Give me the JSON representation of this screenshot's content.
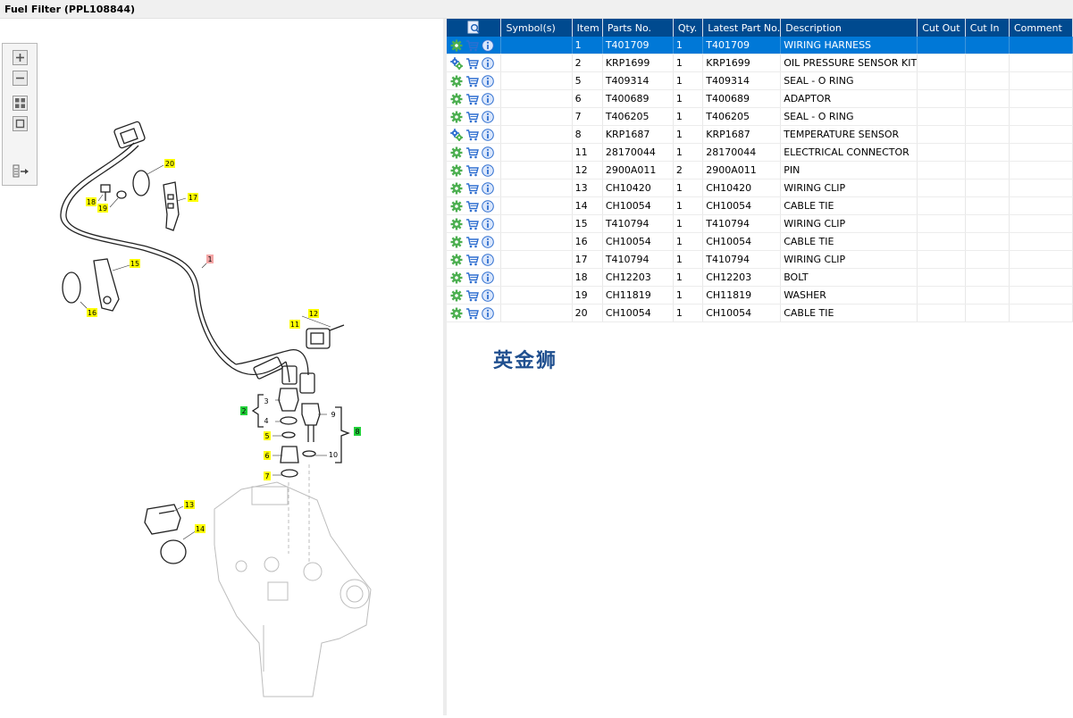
{
  "window": {
    "title": "Fuel Filter (PPL108844)"
  },
  "toolbar": {
    "zoom_in_icon": "plus-icon",
    "zoom_out_icon": "minus-icon",
    "fit_icon": "fit-grid-icon",
    "actual_size_icon": "square-icon",
    "list_icon": "list-arrow-icon"
  },
  "diagram": {
    "callouts": [
      {
        "label": "1",
        "color": "#f4a6a6"
      },
      {
        "label": "2",
        "color": "#22d13a"
      },
      {
        "label": "3",
        "color": "none"
      },
      {
        "label": "4",
        "color": "none"
      },
      {
        "label": "5",
        "color": "#ffff00"
      },
      {
        "label": "6",
        "color": "#ffff00"
      },
      {
        "label": "7",
        "color": "#ffff00"
      },
      {
        "label": "8",
        "color": "#22d13a"
      },
      {
        "label": "9",
        "color": "none"
      },
      {
        "label": "10",
        "color": "none"
      },
      {
        "label": "11",
        "color": "#ffff00"
      },
      {
        "label": "12",
        "color": "#ffff00"
      },
      {
        "label": "13",
        "color": "#ffff00"
      },
      {
        "label": "14",
        "color": "#ffff00"
      },
      {
        "label": "15",
        "color": "#ffff00"
      },
      {
        "label": "16",
        "color": "#ffff00"
      },
      {
        "label": "17",
        "color": "#ffff00"
      },
      {
        "label": "18",
        "color": "#ffff00"
      },
      {
        "label": "19",
        "color": "#ffff00"
      },
      {
        "label": "20",
        "color": "#ffff00"
      }
    ]
  },
  "table": {
    "columns": [
      "",
      "Symbol(s)",
      "Item",
      "Parts No.",
      "Qty.",
      "Latest Part No.",
      "Description",
      "Cut Out",
      "Cut In",
      "Comment"
    ],
    "header_icon": "search-doc-icon",
    "rows": [
      {
        "item": "1",
        "parts_no": "T401709",
        "qty": "1",
        "latest": "T401709",
        "desc": "WIRING HARNESS",
        "icon": "gear-icon",
        "selected": true
      },
      {
        "item": "2",
        "parts_no": "KRP1699",
        "qty": "1",
        "latest": "KRP1699",
        "desc": "OIL PRESSURE SENSOR KIT",
        "icon": "gears-icon"
      },
      {
        "item": "5",
        "parts_no": "T409314",
        "qty": "1",
        "latest": "T409314",
        "desc": "SEAL - O RING",
        "icon": "gear-icon"
      },
      {
        "item": "6",
        "parts_no": "T400689",
        "qty": "1",
        "latest": "T400689",
        "desc": "ADAPTOR",
        "icon": "gear-icon"
      },
      {
        "item": "7",
        "parts_no": "T406205",
        "qty": "1",
        "latest": "T406205",
        "desc": "SEAL - O RING",
        "icon": "gear-icon"
      },
      {
        "item": "8",
        "parts_no": "KRP1687",
        "qty": "1",
        "latest": "KRP1687",
        "desc": "TEMPERATURE SENSOR",
        "icon": "gears-icon"
      },
      {
        "item": "11",
        "parts_no": "28170044",
        "qty": "1",
        "latest": "28170044",
        "desc": "ELECTRICAL CONNECTOR",
        "icon": "gear-icon"
      },
      {
        "item": "12",
        "parts_no": "2900A011",
        "qty": "2",
        "latest": "2900A011",
        "desc": "PIN",
        "icon": "gear-icon"
      },
      {
        "item": "13",
        "parts_no": "CH10420",
        "qty": "1",
        "latest": "CH10420",
        "desc": "WIRING CLIP",
        "icon": "gear-icon"
      },
      {
        "item": "14",
        "parts_no": "CH10054",
        "qty": "1",
        "latest": "CH10054",
        "desc": "CABLE TIE",
        "icon": "gear-icon"
      },
      {
        "item": "15",
        "parts_no": "T410794",
        "qty": "1",
        "latest": "T410794",
        "desc": "WIRING CLIP",
        "icon": "gear-icon"
      },
      {
        "item": "16",
        "parts_no": "CH10054",
        "qty": "1",
        "latest": "CH10054",
        "desc": "CABLE TIE",
        "icon": "gear-icon"
      },
      {
        "item": "17",
        "parts_no": "T410794",
        "qty": "1",
        "latest": "T410794",
        "desc": "WIRING CLIP",
        "icon": "gear-icon"
      },
      {
        "item": "18",
        "parts_no": "CH12203",
        "qty": "1",
        "latest": "CH12203",
        "desc": "BOLT",
        "icon": "gear-icon"
      },
      {
        "item": "19",
        "parts_no": "CH11819",
        "qty": "1",
        "latest": "CH11819",
        "desc": "WASHER",
        "icon": "gear-icon"
      },
      {
        "item": "20",
        "parts_no": "CH10054",
        "qty": "1",
        "latest": "CH10054",
        "desc": "CABLE TIE",
        "icon": "gear-icon"
      }
    ]
  },
  "watermark": {
    "text": "英金狮"
  }
}
